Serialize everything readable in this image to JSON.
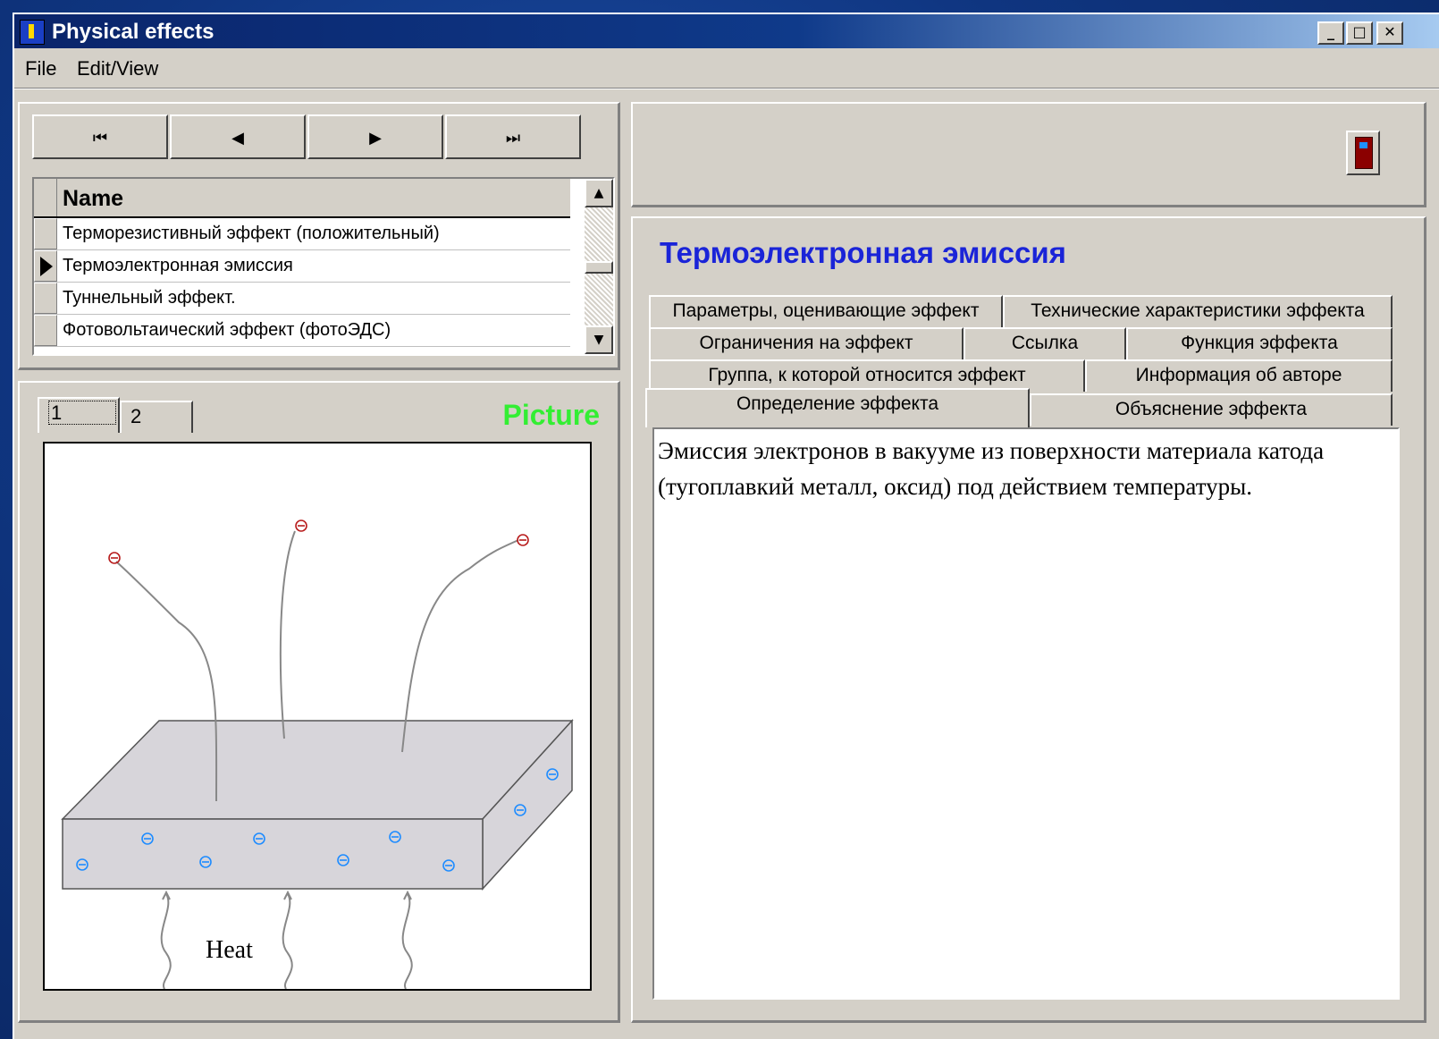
{
  "window": {
    "title": "Physical effects",
    "controls": {
      "minimize": "_",
      "maximize": "□",
      "close": "✕"
    }
  },
  "menu": {
    "file": "File",
    "edit_view": "Edit/View"
  },
  "navigator": {
    "first": "⏮",
    "prev": "◀",
    "next": "▶",
    "last": "⏭"
  },
  "grid": {
    "header": "Name",
    "rows": [
      "Терморезистивный эффект (положительный)",
      "Термоэлектронная эмиссия",
      "Туннельный эффект.",
      "Фотовольтаический эффект (фотоЭДС)"
    ],
    "selected_index": 1
  },
  "picture": {
    "tabs": [
      "1",
      "2"
    ],
    "label": "Picture",
    "diagram_text": "Heat",
    "electron_symbol": "⊖"
  },
  "effect": {
    "title": "Термоэлектронная эмиссия",
    "tabs_row1": [
      "Параметры, оценивающие эффект",
      "Технические характеристики эффекта"
    ],
    "tabs_row2": [
      "Ограничения на эффект",
      "Ссылка",
      "Функция эффекта"
    ],
    "tabs_row3": [
      "Группа, к которой относится эффект",
      "Информация об авторе"
    ],
    "tabs_row4": [
      "Определение эффекта",
      "Объяснение эффекта"
    ],
    "active_tab": "Определение эффекта",
    "definition_text": "Эмиссия электронов в вакууме из поверхности материала катода (тугоплавкий металл, оксид) под действием температуры."
  },
  "colors": {
    "title_bar": "#0a246a",
    "effect_title": "#1a24d8",
    "picture_label": "#33ee33",
    "electron_blue": "#1e8cff",
    "electron_red": "#b81c1c"
  }
}
